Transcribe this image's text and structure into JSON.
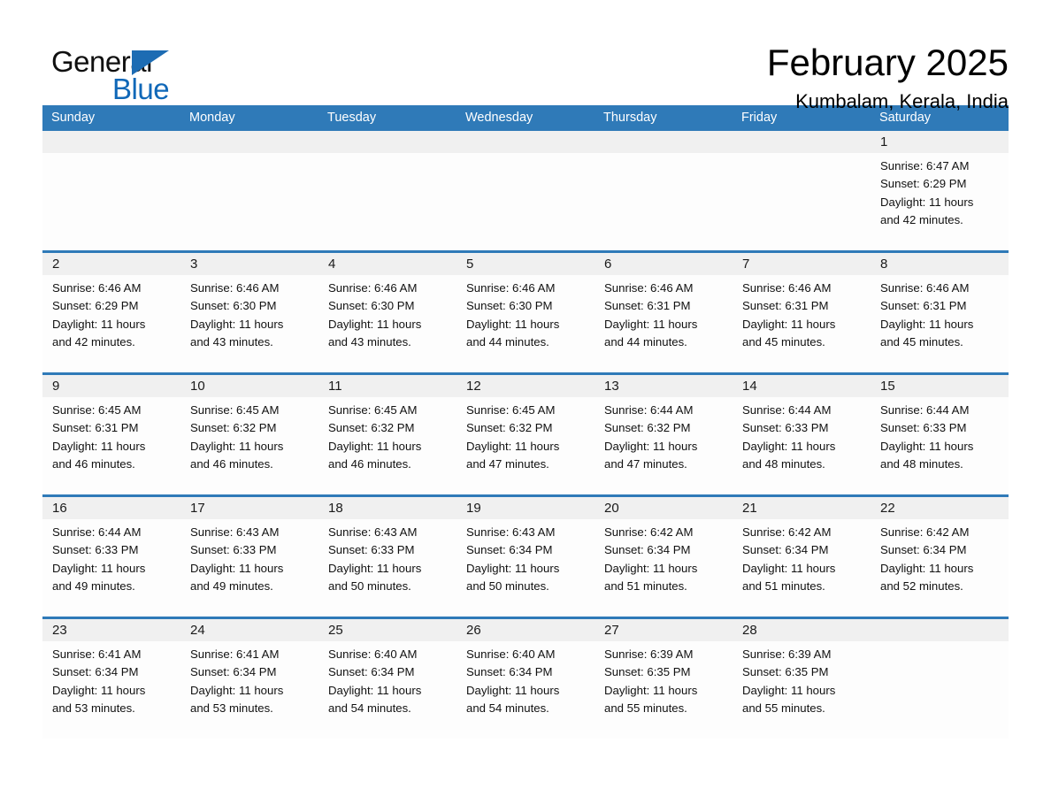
{
  "brand": {
    "name_top": "General",
    "name_bottom": "Blue",
    "accent_color": "#1068b8",
    "flag_color": "#1d6cb3"
  },
  "header": {
    "month_title": "February 2025",
    "location": "Kumbalam, Kerala, India"
  },
  "calendar": {
    "header_bg": "#2f7ab8",
    "header_text_color": "#ffffff",
    "divider_color": "#2f7ab8",
    "day_band_bg": "#f0f0f0",
    "weekdays": [
      "Sunday",
      "Monday",
      "Tuesday",
      "Wednesday",
      "Thursday",
      "Friday",
      "Saturday"
    ],
    "weeks": [
      [
        {
          "day": "",
          "sunrise": "",
          "sunset": "",
          "daylight_1": "",
          "daylight_2": ""
        },
        {
          "day": "",
          "sunrise": "",
          "sunset": "",
          "daylight_1": "",
          "daylight_2": ""
        },
        {
          "day": "",
          "sunrise": "",
          "sunset": "",
          "daylight_1": "",
          "daylight_2": ""
        },
        {
          "day": "",
          "sunrise": "",
          "sunset": "",
          "daylight_1": "",
          "daylight_2": ""
        },
        {
          "day": "",
          "sunrise": "",
          "sunset": "",
          "daylight_1": "",
          "daylight_2": ""
        },
        {
          "day": "",
          "sunrise": "",
          "sunset": "",
          "daylight_1": "",
          "daylight_2": ""
        },
        {
          "day": "1",
          "sunrise": "Sunrise: 6:47 AM",
          "sunset": "Sunset: 6:29 PM",
          "daylight_1": "Daylight: 11 hours",
          "daylight_2": "and 42 minutes."
        }
      ],
      [
        {
          "day": "2",
          "sunrise": "Sunrise: 6:46 AM",
          "sunset": "Sunset: 6:29 PM",
          "daylight_1": "Daylight: 11 hours",
          "daylight_2": "and 42 minutes."
        },
        {
          "day": "3",
          "sunrise": "Sunrise: 6:46 AM",
          "sunset": "Sunset: 6:30 PM",
          "daylight_1": "Daylight: 11 hours",
          "daylight_2": "and 43 minutes."
        },
        {
          "day": "4",
          "sunrise": "Sunrise: 6:46 AM",
          "sunset": "Sunset: 6:30 PM",
          "daylight_1": "Daylight: 11 hours",
          "daylight_2": "and 43 minutes."
        },
        {
          "day": "5",
          "sunrise": "Sunrise: 6:46 AM",
          "sunset": "Sunset: 6:30 PM",
          "daylight_1": "Daylight: 11 hours",
          "daylight_2": "and 44 minutes."
        },
        {
          "day": "6",
          "sunrise": "Sunrise: 6:46 AM",
          "sunset": "Sunset: 6:31 PM",
          "daylight_1": "Daylight: 11 hours",
          "daylight_2": "and 44 minutes."
        },
        {
          "day": "7",
          "sunrise": "Sunrise: 6:46 AM",
          "sunset": "Sunset: 6:31 PM",
          "daylight_1": "Daylight: 11 hours",
          "daylight_2": "and 45 minutes."
        },
        {
          "day": "8",
          "sunrise": "Sunrise: 6:46 AM",
          "sunset": "Sunset: 6:31 PM",
          "daylight_1": "Daylight: 11 hours",
          "daylight_2": "and 45 minutes."
        }
      ],
      [
        {
          "day": "9",
          "sunrise": "Sunrise: 6:45 AM",
          "sunset": "Sunset: 6:31 PM",
          "daylight_1": "Daylight: 11 hours",
          "daylight_2": "and 46 minutes."
        },
        {
          "day": "10",
          "sunrise": "Sunrise: 6:45 AM",
          "sunset": "Sunset: 6:32 PM",
          "daylight_1": "Daylight: 11 hours",
          "daylight_2": "and 46 minutes."
        },
        {
          "day": "11",
          "sunrise": "Sunrise: 6:45 AM",
          "sunset": "Sunset: 6:32 PM",
          "daylight_1": "Daylight: 11 hours",
          "daylight_2": "and 46 minutes."
        },
        {
          "day": "12",
          "sunrise": "Sunrise: 6:45 AM",
          "sunset": "Sunset: 6:32 PM",
          "daylight_1": "Daylight: 11 hours",
          "daylight_2": "and 47 minutes."
        },
        {
          "day": "13",
          "sunrise": "Sunrise: 6:44 AM",
          "sunset": "Sunset: 6:32 PM",
          "daylight_1": "Daylight: 11 hours",
          "daylight_2": "and 47 minutes."
        },
        {
          "day": "14",
          "sunrise": "Sunrise: 6:44 AM",
          "sunset": "Sunset: 6:33 PM",
          "daylight_1": "Daylight: 11 hours",
          "daylight_2": "and 48 minutes."
        },
        {
          "day": "15",
          "sunrise": "Sunrise: 6:44 AM",
          "sunset": "Sunset: 6:33 PM",
          "daylight_1": "Daylight: 11 hours",
          "daylight_2": "and 48 minutes."
        }
      ],
      [
        {
          "day": "16",
          "sunrise": "Sunrise: 6:44 AM",
          "sunset": "Sunset: 6:33 PM",
          "daylight_1": "Daylight: 11 hours",
          "daylight_2": "and 49 minutes."
        },
        {
          "day": "17",
          "sunrise": "Sunrise: 6:43 AM",
          "sunset": "Sunset: 6:33 PM",
          "daylight_1": "Daylight: 11 hours",
          "daylight_2": "and 49 minutes."
        },
        {
          "day": "18",
          "sunrise": "Sunrise: 6:43 AM",
          "sunset": "Sunset: 6:33 PM",
          "daylight_1": "Daylight: 11 hours",
          "daylight_2": "and 50 minutes."
        },
        {
          "day": "19",
          "sunrise": "Sunrise: 6:43 AM",
          "sunset": "Sunset: 6:34 PM",
          "daylight_1": "Daylight: 11 hours",
          "daylight_2": "and 50 minutes."
        },
        {
          "day": "20",
          "sunrise": "Sunrise: 6:42 AM",
          "sunset": "Sunset: 6:34 PM",
          "daylight_1": "Daylight: 11 hours",
          "daylight_2": "and 51 minutes."
        },
        {
          "day": "21",
          "sunrise": "Sunrise: 6:42 AM",
          "sunset": "Sunset: 6:34 PM",
          "daylight_1": "Daylight: 11 hours",
          "daylight_2": "and 51 minutes."
        },
        {
          "day": "22",
          "sunrise": "Sunrise: 6:42 AM",
          "sunset": "Sunset: 6:34 PM",
          "daylight_1": "Daylight: 11 hours",
          "daylight_2": "and 52 minutes."
        }
      ],
      [
        {
          "day": "23",
          "sunrise": "Sunrise: 6:41 AM",
          "sunset": "Sunset: 6:34 PM",
          "daylight_1": "Daylight: 11 hours",
          "daylight_2": "and 53 minutes."
        },
        {
          "day": "24",
          "sunrise": "Sunrise: 6:41 AM",
          "sunset": "Sunset: 6:34 PM",
          "daylight_1": "Daylight: 11 hours",
          "daylight_2": "and 53 minutes."
        },
        {
          "day": "25",
          "sunrise": "Sunrise: 6:40 AM",
          "sunset": "Sunset: 6:34 PM",
          "daylight_1": "Daylight: 11 hours",
          "daylight_2": "and 54 minutes."
        },
        {
          "day": "26",
          "sunrise": "Sunrise: 6:40 AM",
          "sunset": "Sunset: 6:34 PM",
          "daylight_1": "Daylight: 11 hours",
          "daylight_2": "and 54 minutes."
        },
        {
          "day": "27",
          "sunrise": "Sunrise: 6:39 AM",
          "sunset": "Sunset: 6:35 PM",
          "daylight_1": "Daylight: 11 hours",
          "daylight_2": "and 55 minutes."
        },
        {
          "day": "28",
          "sunrise": "Sunrise: 6:39 AM",
          "sunset": "Sunset: 6:35 PM",
          "daylight_1": "Daylight: 11 hours",
          "daylight_2": "and 55 minutes."
        },
        {
          "day": "",
          "sunrise": "",
          "sunset": "",
          "daylight_1": "",
          "daylight_2": ""
        }
      ]
    ]
  }
}
